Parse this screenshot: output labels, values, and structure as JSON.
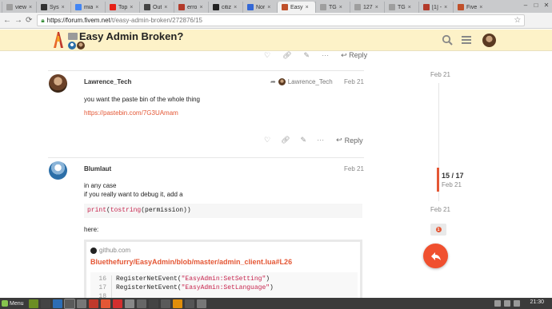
{
  "browser": {
    "tabs": [
      {
        "title": "view",
        "color": "#9e9e9e"
      },
      {
        "title": "Sys",
        "color": "#333333"
      },
      {
        "title": "mia",
        "color": "#4285f4"
      },
      {
        "title": "Top",
        "color": "#e62117"
      },
      {
        "title": "Out",
        "color": "#444444"
      },
      {
        "title": "erro",
        "color": "#b33a2a"
      },
      {
        "title": "citiz",
        "color": "#222222"
      },
      {
        "title": "Nor",
        "color": "#3367d6"
      },
      {
        "title": "Easy",
        "color": "#c0502a"
      },
      {
        "title": "TG",
        "color": "#9e9e9e"
      },
      {
        "title": "127",
        "color": "#9e9e9e"
      },
      {
        "title": "TG",
        "color": "#9e9e9e"
      },
      {
        "title": "[1] -",
        "color": "#b33a2a"
      },
      {
        "title": "Five",
        "color": "#c0502a"
      }
    ],
    "active_tab": 8,
    "url_host": "https://forum.fivem.net",
    "url_path": "/t/easy-admin-broken/272876/15"
  },
  "forum": {
    "topic_title": "Easy Admin Broken?"
  },
  "top_post": {
    "reply_label": "Reply"
  },
  "post1": {
    "username": "Lawrence_Tech",
    "date": "Feb 21",
    "reply_to_user": "Lawrence_Tech",
    "body": "you want the paste bin of the whole thing",
    "link": "https://pastebin.com/7G3UAmam",
    "reply_label": "Reply"
  },
  "post2": {
    "username": "Blumlaut",
    "date": "Feb 21",
    "line1": "in any case",
    "line2": "if you really want to debug it, add a",
    "code_fn1": "print",
    "code_fn2": "tostring",
    "code_arg": "(permission))",
    "here": "here:",
    "onebox_source": "github.com",
    "onebox_link": "Bluethefurry/EasyAdmin/blob/master/admin_client.lua#L26",
    "code_lines": [
      {
        "num": "16",
        "pre": "RegisterNetEvent(",
        "str": "\"EasyAdmin:SetSetting\"",
        "post": ")"
      },
      {
        "num": "17",
        "pre": "RegisterNetEvent(",
        "str": "\"EasyAdmin:SetLanguage\"",
        "post": ")"
      },
      {
        "num": "18",
        "pre": "",
        "str": "",
        "post": ""
      }
    ]
  },
  "timeline": {
    "top_date": "Feb 21",
    "counter": "15 / 17",
    "handle_date": "Feb 21",
    "bottom_date": "Feb 21",
    "notification_count": "1"
  },
  "taskbar": {
    "menu_label": "Menu",
    "clock": "21:30"
  },
  "colors": {
    "accent": "#e45735",
    "header_bg": "#fdf2c8"
  }
}
